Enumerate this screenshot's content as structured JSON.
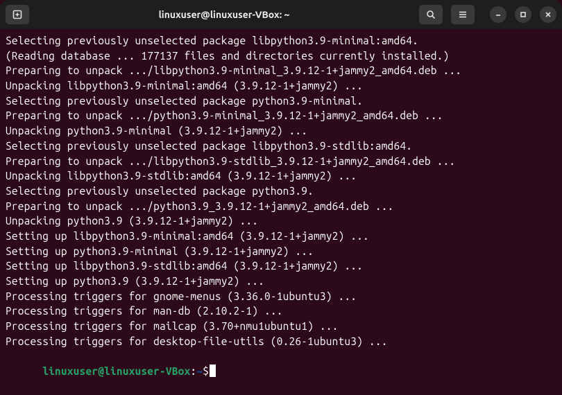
{
  "titlebar": {
    "title": "linuxuser@linuxuser-VBox: ~"
  },
  "prompt": {
    "user_host": "linuxuser@linuxuser-VBox",
    "colon": ":",
    "path": "~",
    "dollar": "$"
  },
  "lines": [
    "Selecting previously unselected package libpython3.9-minimal:amd64.",
    "(Reading database ... 177137 files and directories currently installed.)",
    "Preparing to unpack .../libpython3.9-minimal_3.9.12-1+jammy2_amd64.deb ...",
    "Unpacking libpython3.9-minimal:amd64 (3.9.12-1+jammy2) ...",
    "Selecting previously unselected package python3.9-minimal.",
    "Preparing to unpack .../python3.9-minimal_3.9.12-1+jammy2_amd64.deb ...",
    "Unpacking python3.9-minimal (3.9.12-1+jammy2) ...",
    "Selecting previously unselected package libpython3.9-stdlib:amd64.",
    "Preparing to unpack .../libpython3.9-stdlib_3.9.12-1+jammy2_amd64.deb ...",
    "Unpacking libpython3.9-stdlib:amd64 (3.9.12-1+jammy2) ...",
    "Selecting previously unselected package python3.9.",
    "Preparing to unpack .../python3.9_3.9.12-1+jammy2_amd64.deb ...",
    "Unpacking python3.9 (3.9.12-1+jammy2) ...",
    "Setting up libpython3.9-minimal:amd64 (3.9.12-1+jammy2) ...",
    "Setting up python3.9-minimal (3.9.12-1+jammy2) ...",
    "Setting up libpython3.9-stdlib:amd64 (3.9.12-1+jammy2) ...",
    "Setting up python3.9 (3.9.12-1+jammy2) ...",
    "Processing triggers for gnome-menus (3.36.0-1ubuntu3) ...",
    "Processing triggers for man-db (2.10.2-1) ...",
    "Processing triggers for mailcap (3.70+nmu1ubuntu1) ...",
    "Processing triggers for desktop-file-utils (0.26-1ubuntu3) ..."
  ]
}
